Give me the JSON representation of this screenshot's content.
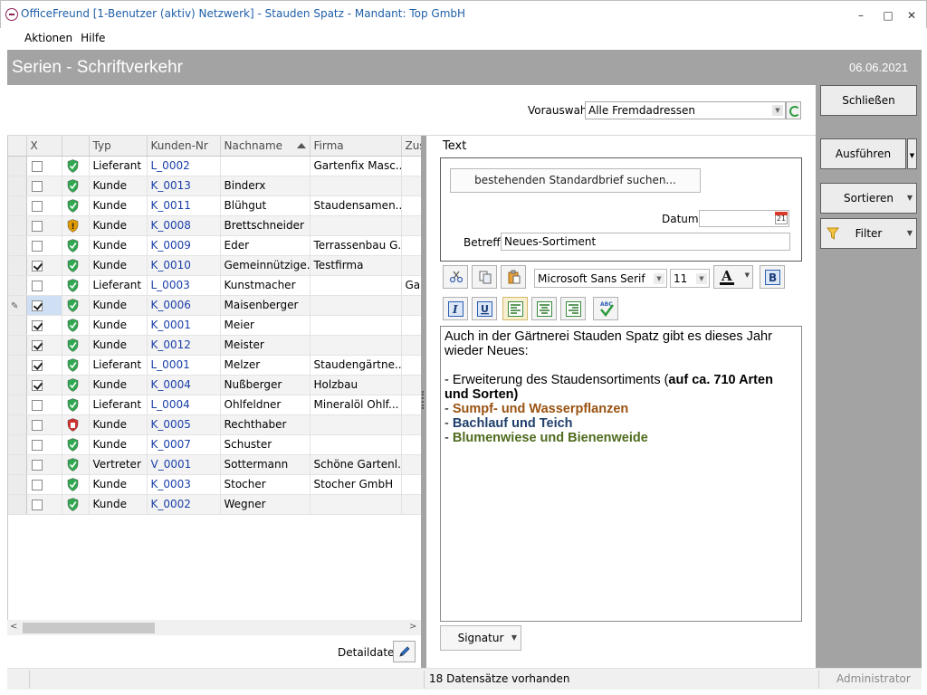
{
  "window": {
    "title": "OfficeFreund [1-Benutzer (aktiv) Netzwerk]  -  Stauden Spatz  -  Mandant: Top GmbH",
    "minimize": "–",
    "maximize": "□",
    "close": "✕"
  },
  "menu": [
    "Aktionen",
    "Hilfe"
  ],
  "header": {
    "title": "Serien - Schriftverkehr",
    "date": "06.06.2021"
  },
  "vorauswahl": {
    "label": "Vorauswahl:",
    "value": "Alle Fremdadressen"
  },
  "grid": {
    "columns": [
      "X",
      "",
      "Typ",
      "Kunden-Nr",
      "Nachname",
      "Firma",
      "Zus"
    ],
    "rows": [
      {
        "checked": false,
        "status": "green",
        "typ": "Lieferant",
        "nr": "L_0002",
        "name": "",
        "firma": "Gartenfix  Masc...",
        "zus": ""
      },
      {
        "checked": false,
        "status": "green",
        "typ": "Kunde",
        "nr": "K_0013",
        "name": "Binderx",
        "firma": "",
        "zus": ""
      },
      {
        "checked": false,
        "status": "green",
        "typ": "Kunde",
        "nr": "K_0011",
        "name": "Blühgut",
        "firma": "Staudensamen...",
        "zus": ""
      },
      {
        "checked": false,
        "status": "orange",
        "typ": "Kunde",
        "nr": "K_0008",
        "name": "Brettschneider",
        "firma": "",
        "zus": ""
      },
      {
        "checked": false,
        "status": "green",
        "typ": "Kunde",
        "nr": "K_0009",
        "name": "Eder",
        "firma": "Terrassenbau G...",
        "zus": ""
      },
      {
        "checked": true,
        "status": "green",
        "typ": "Kunde",
        "nr": "K_0010",
        "name": "Gemeinnützige...",
        "firma": "Testfirma",
        "zus": ""
      },
      {
        "checked": false,
        "status": "green",
        "typ": "Lieferant",
        "nr": "L_0003",
        "name": "Kunstmacher",
        "firma": "",
        "zus": "Gar"
      },
      {
        "checked": true,
        "status": "green",
        "typ": "Kunde",
        "nr": "K_0006",
        "name": "Maisenberger",
        "firma": "",
        "zus": "",
        "editing": true
      },
      {
        "checked": true,
        "status": "green",
        "typ": "Kunde",
        "nr": "K_0001",
        "name": "Meier",
        "firma": "",
        "zus": ""
      },
      {
        "checked": true,
        "status": "green",
        "typ": "Kunde",
        "nr": "K_0012",
        "name": "Meister",
        "firma": "",
        "zus": ""
      },
      {
        "checked": true,
        "status": "green",
        "typ": "Lieferant",
        "nr": "L_0001",
        "name": "Melzer",
        "firma": "Staudengärtne...",
        "zus": ""
      },
      {
        "checked": true,
        "status": "green",
        "typ": "Kunde",
        "nr": "K_0004",
        "name": "Nußberger",
        "firma": "Holzbau",
        "zus": ""
      },
      {
        "checked": false,
        "status": "green",
        "typ": "Lieferant",
        "nr": "L_0004",
        "name": "Ohlfeldner",
        "firma": "Mineralöl Ohlf...",
        "zus": ""
      },
      {
        "checked": false,
        "status": "red",
        "typ": "Kunde",
        "nr": "K_0005",
        "name": "Rechthaber",
        "firma": "",
        "zus": ""
      },
      {
        "checked": false,
        "status": "green",
        "typ": "Kunde",
        "nr": "K_0007",
        "name": "Schuster",
        "firma": "",
        "zus": ""
      },
      {
        "checked": false,
        "status": "green",
        "typ": "Vertreter",
        "nr": "V_0001",
        "name": "Sottermann",
        "firma": "Schöne Gartenl...",
        "zus": ""
      },
      {
        "checked": false,
        "status": "green",
        "typ": "Kunde",
        "nr": "K_0003",
        "name": "Stocher",
        "firma": "Stocher GmbH",
        "zus": ""
      },
      {
        "checked": false,
        "status": "green",
        "typ": "Kunde",
        "nr": "K_0002",
        "name": "Wegner",
        "firma": "",
        "zus": ""
      }
    ]
  },
  "detail": {
    "label": "Detaildaten:"
  },
  "text": {
    "label": "Text",
    "search_button": "bestehenden Standardbrief suchen...",
    "datum_label": "Datum:",
    "datum_value": "",
    "betreff_label": "Betreff:",
    "betreff_value": "Neues-Sortiment",
    "font": "Microsoft Sans Serif",
    "size": "11",
    "body": {
      "line1": "Auch in der Gärtnerei Stauden Spatz gibt es dieses Jahr wieder Neues:",
      "item1_prefix": "- Erweiterung des Staudensortiments (",
      "item1_bold": "auf ca. 710 Arten und Sorten)",
      "dash": "- ",
      "item2": "Sumpf- und Wasserpflanzen",
      "item3": "Bachlauf und Teich",
      "item4": "Blumenwiese und Bienenweide"
    },
    "signature": "Signatur"
  },
  "sidebar": {
    "close": "Schließen",
    "execute": "Ausführen",
    "sort": "Sortieren",
    "filter": "Filter"
  },
  "status": {
    "count": "18 Datensätze vorhanden",
    "user": "Administrator"
  },
  "colors": {
    "header_bg": "#a3a3a3",
    "link_blue": "#1a3fa8",
    "item2": "#9a5211",
    "item3": "#1f3f6b",
    "item4": "#4f6b1e",
    "shield_green": "#2fa84f",
    "shield_orange": "#e09a00",
    "shield_red": "#d03030"
  },
  "icons": [
    "app-icon",
    "refresh-icon",
    "shield-icon",
    "pencil-icon",
    "calendar-icon",
    "cut-icon",
    "copy-icon",
    "paste-icon",
    "font-color-icon",
    "bold-icon",
    "italic-icon",
    "underline-icon",
    "align-left-icon",
    "align-center-icon",
    "align-right-icon",
    "spellcheck-icon",
    "filter-icon"
  ]
}
